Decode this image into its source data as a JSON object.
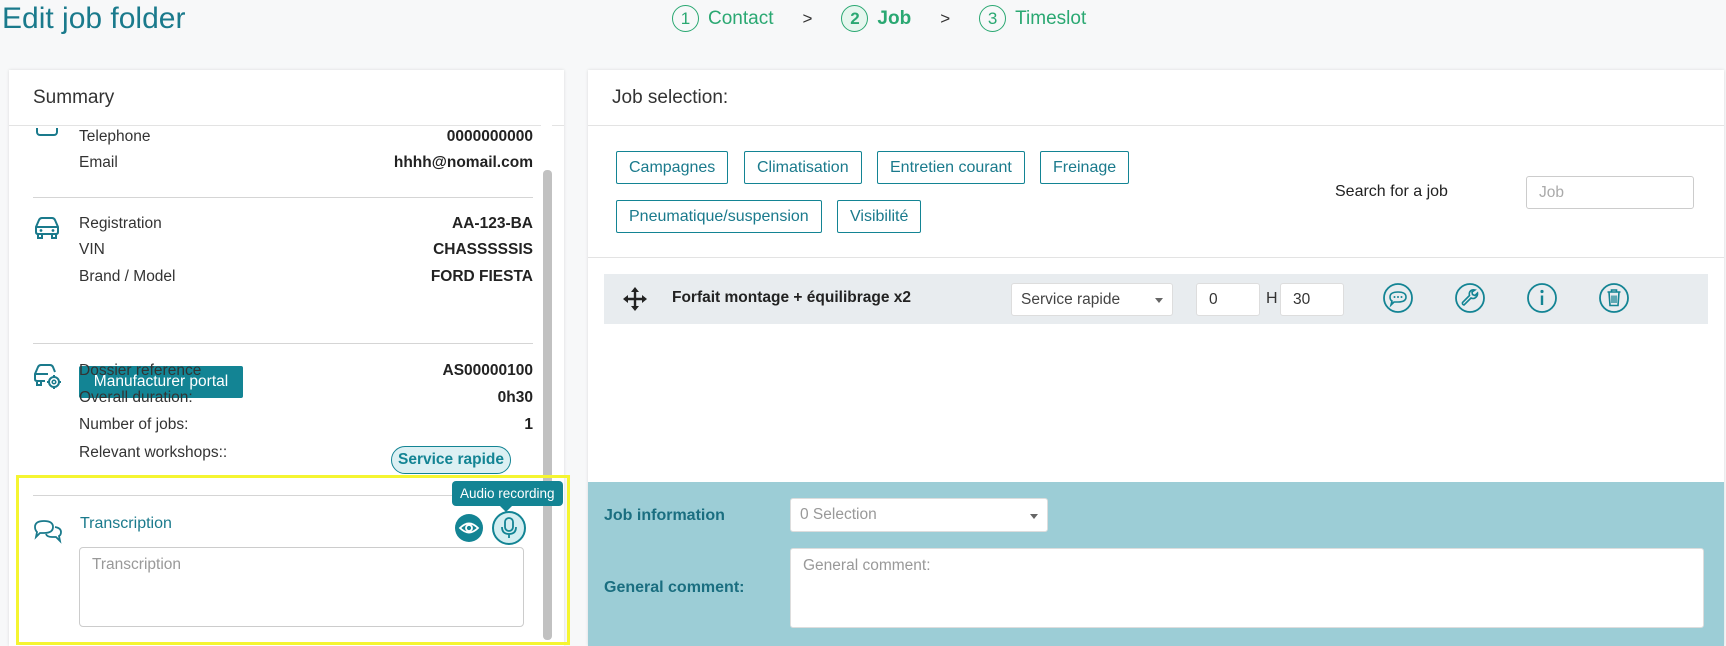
{
  "page": {
    "title": "Edit job folder"
  },
  "stepper": {
    "steps": [
      {
        "num": "1",
        "label": "Contact"
      },
      {
        "num": "2",
        "label": "Job"
      },
      {
        "num": "3",
        "label": "Timeslot"
      }
    ],
    "separator": ">"
  },
  "summary": {
    "title": "Summary",
    "contact": {
      "telephone_label": "Telephone",
      "telephone_value": "0000000000",
      "email_label": "Email",
      "email_value": "hhhh@nomail.com"
    },
    "vehicle": {
      "registration_label": "Registration",
      "registration_value": "AA-123-BA",
      "vin_label": "VIN",
      "vin_value": "CHASSSSSIS",
      "brand_label": "Brand / Model",
      "brand_value": "FORD FIESTA",
      "portal_button": "Manufacturer portal"
    },
    "dossier": {
      "reference_label": "Dossier reference",
      "reference_value": "AS00000100",
      "duration_label": "Overall duration:",
      "duration_value": "0h30",
      "jobs_label": "Number of jobs:",
      "jobs_value": "1",
      "workshops_label": "Relevant workshops::",
      "workshop_badge": "Service rapide"
    },
    "transcription": {
      "label": "Transcription",
      "placeholder": "Transcription",
      "tooltip": "Audio recording"
    }
  },
  "job_selection": {
    "title": "Job selection:",
    "categories": [
      "Campagnes",
      "Climatisation",
      "Entretien courant",
      "Freinage",
      "Pneumatique/suspension",
      "Visibilité"
    ],
    "search_label": "Search for a job",
    "search_placeholder": "Job",
    "job": {
      "name": "Forfait montage + équilibrage x2",
      "workshop": "Service rapide",
      "hours": "0",
      "hours_label": "H",
      "minutes": "30"
    }
  },
  "job_information": {
    "label": "Job information",
    "select_value": "0 Selection",
    "comment_label": "General comment:",
    "comment_placeholder": "General comment:"
  }
}
